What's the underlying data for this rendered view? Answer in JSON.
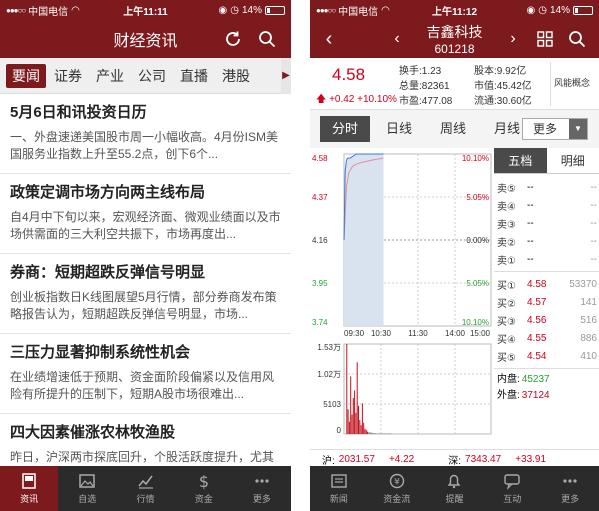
{
  "left": {
    "status": {
      "carrier": "中国电信",
      "time": "上午11:11",
      "battery": "14%",
      "battery_level": 0.14
    },
    "header": {
      "title": "财经资讯"
    },
    "tabs": [
      "要闻",
      "证券",
      "产业",
      "公司",
      "直播",
      "港股"
    ],
    "news": [
      {
        "title": "5月6日和讯投资日历",
        "summary": "一、外盘速递美国股市周一小幅收高。4月份ISM美国服务业指数上升至55.2点，创下6个..."
      },
      {
        "title": "政策定调市场方向两主线布局",
        "summary": "自4月中下旬以来，宏观经济面、微观业绩面以及市场供需面的三大利空共振下，市场再度出..."
      },
      {
        "title": "券商：短期超跌反弹信号明显",
        "summary": "创业板指数日K线图展望5月行情，部分券商发布策略报告认为，短期超跌反弹信号明显，市场..."
      },
      {
        "title": "三压力显著抑制系统性机会",
        "summary": "在业绩增速低于预期、资金面阶段偏紧以及信用风险有所提升的压制下，短期A股市场很难出..."
      },
      {
        "title": "四大因素催涨农林牧渔股",
        "summary": "昨日，沪深两市探底回升，个股活跃度提升，尤其是农林牧渔板块表现突出，下向德农(60037..."
      }
    ],
    "nav": [
      "资讯",
      "自选",
      "行情",
      "资金",
      "更多"
    ]
  },
  "right": {
    "status": {
      "carrier": "中国电信",
      "time": "上午11:12",
      "battery": "14%",
      "battery_level": 0.14
    },
    "header": {
      "name": "吉鑫科技",
      "code": "601218"
    },
    "quote": {
      "price": "4.58",
      "change": "+0.42",
      "change_pct": "+10.10%",
      "turnover_label": "换手:",
      "turnover": "1.23",
      "share_cap_label": "股本:",
      "share_cap": "9.92亿",
      "total_vol_label": "总量:",
      "total_vol": "82361",
      "mkt_cap_label": "市值:",
      "mkt_cap": "45.42亿",
      "amount_label": "市盈:",
      "amount": "477.08",
      "float_label": "流通:",
      "float": "30.60亿",
      "risk": "风能概念"
    },
    "periods": [
      "分时",
      "日线",
      "周线",
      "月线"
    ],
    "period_more": "更多",
    "chart_data": {
      "type": "line",
      "y_left_labels": [
        "4.58",
        "4.37",
        "4.16",
        "3.95",
        "3.74"
      ],
      "y_right_labels": [
        "10.10%",
        "5.05%",
        "0.00%",
        "5.05%",
        "10.10%"
      ],
      "x_labels": [
        "09:30",
        "10:30",
        "11:30",
        "14:00",
        "15:00"
      ],
      "ylim": [
        3.74,
        4.58
      ],
      "price_series": {
        "x": [
          0,
          2,
          4,
          6,
          8,
          10,
          15,
          20,
          30,
          45,
          60,
          64
        ],
        "values": [
          4.16,
          4.5,
          4.55,
          4.56,
          4.56,
          4.56,
          4.57,
          4.58,
          4.58,
          4.58,
          4.58,
          4.58
        ]
      },
      "avg_series": {
        "x": [
          0,
          4,
          8,
          14,
          20,
          30,
          45,
          64
        ],
        "values": [
          4.16,
          4.42,
          4.49,
          4.52,
          4.53,
          4.54,
          4.55,
          4.56
        ]
      },
      "volume_labels": [
        "1.53万",
        "1.02万",
        "5103",
        "0"
      ],
      "volume_ylim": [
        0,
        15300
      ],
      "volume": [
        0,
        15300,
        4200,
        2100,
        9800,
        3300,
        6100,
        7400,
        3600,
        12200,
        4800,
        2400,
        1500,
        5200,
        1900,
        900,
        700,
        400,
        300,
        300,
        200,
        200,
        150,
        150,
        100,
        100,
        100,
        100,
        100,
        100,
        100,
        100,
        100,
        100,
        100,
        100
      ]
    },
    "order_tabs": [
      "五档",
      "明细"
    ],
    "sells": [
      {
        "label": "卖⑤",
        "price": "--",
        "vol": "--"
      },
      {
        "label": "卖④",
        "price": "--",
        "vol": "--"
      },
      {
        "label": "卖③",
        "price": "--",
        "vol": "--"
      },
      {
        "label": "卖②",
        "price": "--",
        "vol": "--"
      },
      {
        "label": "卖①",
        "price": "--",
        "vol": "--"
      }
    ],
    "buys": [
      {
        "label": "买①",
        "price": "4.58",
        "vol": "53370"
      },
      {
        "label": "买②",
        "price": "4.57",
        "vol": "141"
      },
      {
        "label": "买③",
        "price": "4.56",
        "vol": "516"
      },
      {
        "label": "买④",
        "price": "4.55",
        "vol": "886"
      },
      {
        "label": "买⑤",
        "price": "4.54",
        "vol": "410"
      }
    ],
    "inner_label": "内盘:",
    "inner": "45237",
    "outer_label": "外盘:",
    "outer": "37124",
    "index": {
      "sh_label": "沪:",
      "sh": "2031.57",
      "sh_chg": "+4.22",
      "sz_label": "深:",
      "sz": "7343.47",
      "sz_chg": "+33.91"
    },
    "nav": [
      "新闻",
      "资金流",
      "提醒",
      "互动",
      "更多"
    ]
  },
  "colors": {
    "brand": "#7d1a1d",
    "up": "#d0021b",
    "down": "#2aa036",
    "nav": "#2b2b2b"
  }
}
